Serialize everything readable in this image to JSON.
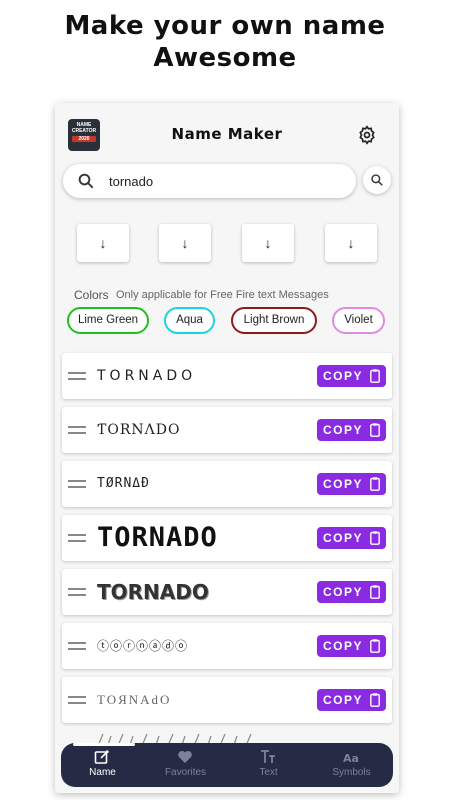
{
  "headline": {
    "line1": "Make your own name",
    "line2": "Awesome"
  },
  "app": {
    "title": "Name Maker",
    "logo_text": "NAME CREATOR",
    "logo_year": "2020"
  },
  "search": {
    "value": "tornado",
    "placeholder": ""
  },
  "arrow_buttons": [
    "↓",
    "↓",
    "↓",
    "↓"
  ],
  "colors": {
    "label": "Colors",
    "note": "Only applicable for Free Fire text Messages",
    "chips": [
      {
        "label": "Lime Green",
        "color": "#1fbf1f"
      },
      {
        "label": "Aqua",
        "color": "#18d3e0"
      },
      {
        "label": "Light Brown",
        "color": "#8b1a1a"
      },
      {
        "label": "Violet",
        "color": "#e08be0"
      }
    ]
  },
  "rows": [
    {
      "text": "TORNADO"
    },
    {
      "text": "ƬORNΛDO"
    },
    {
      "text": "TØRNΔÐ"
    },
    {
      "text": "TORNADO"
    },
    {
      "text": "TORNADO"
    },
    {
      "text": "ⓣⓞⓡⓝⓐⓓⓞ"
    },
    {
      "text": "TOЯNAdO"
    }
  ],
  "copy_label": "COPY",
  "accent_color": "#8a2be2",
  "nav": {
    "items": [
      {
        "label": "Name",
        "icon": "edit-icon",
        "active": true
      },
      {
        "label": "Favorites",
        "icon": "heart-icon",
        "active": false
      },
      {
        "label": "Text",
        "icon": "text-size-icon",
        "active": false
      },
      {
        "label": "Symbols",
        "icon": "symbols-icon",
        "active": false
      }
    ]
  }
}
